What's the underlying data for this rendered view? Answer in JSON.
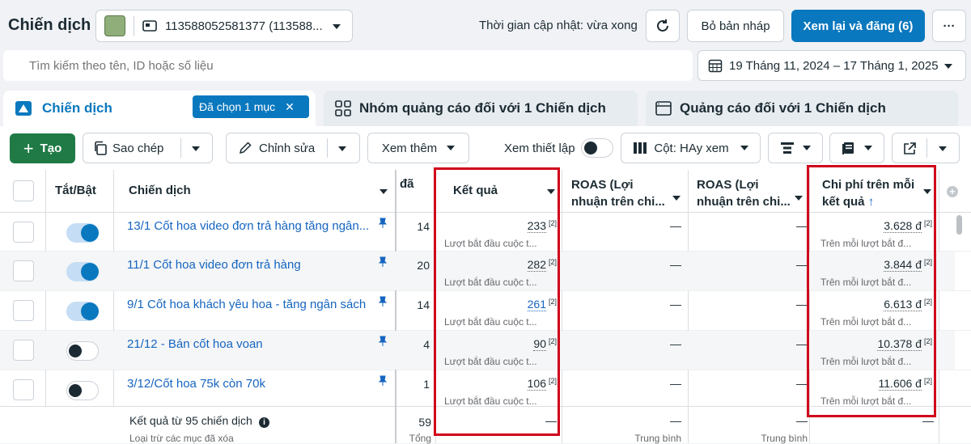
{
  "header": {
    "title": "Chiến dịch",
    "account": "113588052581377 (113588...",
    "updated": "Thời gian cập nhật: vừa xong",
    "discard_label": "Bỏ bản nháp",
    "publish_label": "Xem lại và đăng (6)",
    "more": "···"
  },
  "search": {
    "placeholder": "Tìm kiếm theo tên, ID hoặc số liệu"
  },
  "date_range": "19 Tháng 11, 2024 – 17 Tháng 1, 2025",
  "tabs": [
    {
      "label": "Chiến dịch",
      "badge": "Đã chọn 1 mục",
      "close": "✕"
    },
    {
      "label": "Nhóm quảng cáo đối với 1 Chiến dịch"
    },
    {
      "label": "Quảng cáo đối với 1 Chiến dịch"
    }
  ],
  "toolbar": {
    "create": "Tạo",
    "create_icon": "+",
    "copy": "Sao chép",
    "edit": "Chỉnh sửa",
    "view_more": "Xem thêm",
    "view_setup": "Xem thiết lập",
    "columns": "Cột: HAy xem"
  },
  "table": {
    "headers": {
      "toggle": "Tắt/Bật",
      "campaign": "Chiến dịch",
      "partial": "đã",
      "result": "Kết quả",
      "roas1_line1": "ROAS (Lợi",
      "roas1_line2": "nhuận trên chi...",
      "roas2_line1": "ROAS (Lợi",
      "roas2_line2": "nhuận trên chi...",
      "cost_line1": "Chi phí trên mỗi",
      "cost_line2": "kết quả",
      "sort": "↑"
    },
    "rows": [
      {
        "name": "13/1 Cốt hoa video đơn trả hàng tăng ngân...",
        "on": true,
        "count": "14",
        "result": "233",
        "result_note": "[2]",
        "result_sub": "Lượt bắt đầu cuộc t...",
        "roas1": "—",
        "roas2": "—",
        "cost": "3.628 đ",
        "cost_note": "[2]",
        "cost_sub": "Trên mỗi lượt bắt đ..."
      },
      {
        "name": "11/1 Cốt hoa video đơn trả hàng",
        "on": true,
        "count": "20",
        "result": "282",
        "result_note": "[2]",
        "result_sub": "Lượt bắt đầu cuộc t...",
        "roas1": "—",
        "roas2": "—",
        "cost": "3.844 đ",
        "cost_note": "[2]",
        "cost_sub": "Trên mỗi lượt bắt đ..."
      },
      {
        "name": "9/1 Cốt hoa khách yêu hoa - tăng ngân sách",
        "on": true,
        "count": "14",
        "result": "261",
        "result_note": "[2]",
        "result_sub": "Lượt bắt đầu cuộc t...",
        "roas1": "—",
        "roas2": "—",
        "cost": "6.613 đ",
        "cost_note": "[2]",
        "cost_sub": "Trên mỗi lượt bắt đ..."
      },
      {
        "name": "21/12 - Bán cốt hoa voan",
        "on": false,
        "count": "4",
        "result": "90",
        "result_note": "[2]",
        "result_sub": "Lượt bắt đầu cuộc t...",
        "roas1": "—",
        "roas2": "—",
        "cost": "10.378 đ",
        "cost_note": "[2]",
        "cost_sub": "Trên mỗi lượt bắt đ..."
      },
      {
        "name": "3/12/Cốt hoa 75k còn 70k",
        "on": false,
        "count": "1",
        "result": "106",
        "result_note": "[2]",
        "result_sub": "Lượt bắt đầu cuộc t...",
        "roas1": "—",
        "roas2": "—",
        "cost": "11.606 đ",
        "cost_note": "[2]",
        "cost_sub": "Trên mỗi lượt bắt đ..."
      }
    ],
    "footer": {
      "label": "Kết quả từ 95 chiến dịch",
      "info_icon": "i",
      "sub": "Loại trừ các mục đã xóa",
      "count": "59",
      "count_sub": "Tổng",
      "result": "—",
      "roas1": "—",
      "roas1_sub": "Trung bình",
      "roas2": "—",
      "roas2_sub": "Trung bình",
      "cost": "—"
    }
  },
  "colors": {
    "accent": "#0a78be",
    "create": "#1f7a45",
    "highlight": "#d0021b"
  }
}
